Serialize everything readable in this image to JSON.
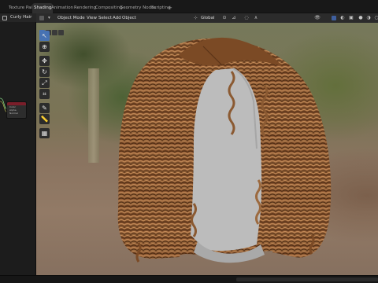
{
  "workspace_tabs": [
    {
      "label": "Texture Paint",
      "active": false
    },
    {
      "label": "Shading",
      "active": true
    },
    {
      "label": "Animation",
      "active": false
    },
    {
      "label": "Rendering",
      "active": false
    },
    {
      "label": "Compositing",
      "active": false
    },
    {
      "label": "Geometry Nodes",
      "active": false
    },
    {
      "label": "Scripting",
      "active": false
    }
  ],
  "add_workspace": "+",
  "node_editor": {
    "material_name": "Curly Hair",
    "node_rows": [
      "Color",
      "Alpha",
      "Normal"
    ]
  },
  "viewport_header": {
    "mode": "Object Mode",
    "menus": [
      "View",
      "Select",
      "Add",
      "Object"
    ],
    "transform_orientation": "Global"
  },
  "toolbar": {
    "tools": [
      "select-tool",
      "cursor-tool",
      "move-tool",
      "rotate-tool",
      "scale-tool",
      "transform-tool",
      "annotate-tool",
      "measure-tool",
      "add-cube-tool"
    ]
  },
  "colors": {
    "accent": "#4772b3",
    "hair_dark": "#5a3418",
    "hair_mid": "#8b5a32",
    "hair_light": "#b47e4e",
    "head_mesh": "#b9b9b9"
  }
}
